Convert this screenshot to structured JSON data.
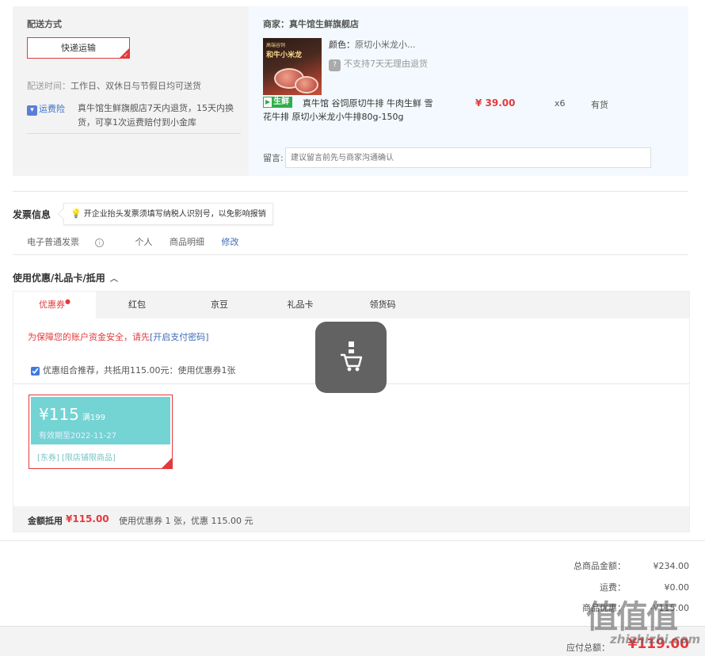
{
  "shipping": {
    "title": "配送方式",
    "option_label": "快递运输",
    "time_label": "配送时间：",
    "time_value": "工作日、双休日与节假日均可送货",
    "insurance_badge": "运费险",
    "insurance_text": "真牛馆生鲜旗舰店7天内退货，15天内换货，可享1次运费赔付到小金库"
  },
  "merchant": {
    "name": "商家：真牛馆生鲜旗舰店",
    "image_text_1": "高端谷饲",
    "image_text_2": "和牛小米龙",
    "color_label": "颜色：",
    "color_value": "原切小米龙小...",
    "return_policy": "不支持7天无理由退货",
    "fresh_tag": "生鲜",
    "product_title": "真牛馆 谷饲原切牛排 牛肉生鲜 雪花牛排 原切小米龙小牛排80g-150g",
    "price": "¥ 39.00",
    "qty": "x6",
    "stock": "有货",
    "note_label": "留言:",
    "note_placeholder": "建议留言前先与商家沟通确认"
  },
  "invoice": {
    "title": "发票信息",
    "tip": "开企业抬头发票须填写纳税人识别号，以免影响报销",
    "type": "电子普通发票",
    "holder": "个人",
    "content": "商品明细",
    "edit": "修改"
  },
  "coupon": {
    "title": "使用优惠/礼品卡/抵用",
    "tabs": [
      {
        "label": "优惠券",
        "active": true
      },
      {
        "label": "红包"
      },
      {
        "label": "京豆"
      },
      {
        "label": "礼品卡"
      },
      {
        "label": "领货码"
      }
    ],
    "tab_dot": "●",
    "security_tip": "为保障您的账户资金安全，请先",
    "security_link": "[开启支付密码]",
    "combo_text": "优惠组合推荐，共抵用115.00元：使用优惠券1张",
    "card": {
      "amount": "¥115",
      "condition": "满199",
      "expire": "有效期至2022-11-27",
      "tags": "[东券] [限店铺限商品]"
    },
    "summary_label": "金额抵用",
    "summary_amount": "¥115.00",
    "summary_desc": "使用优惠券 1 张，优惠 115.00 元"
  },
  "totals": {
    "goods_label": "总商品金额：",
    "goods_value": "¥234.00",
    "shipping_label": "运费：",
    "shipping_value": "¥0.00",
    "discount_label": "商品优惠：",
    "discount_value": "-¥115.00",
    "pay_label": "应付总额：",
    "pay_value": "¥119.00"
  },
  "watermark": {
    "glyphs": "值值值",
    "site": "zhizhizhi.com"
  },
  "colors": {
    "accent": "#e4393c",
    "link": "#3e6bb8",
    "coupon": "#74d3d3",
    "fresh": "#2fad4b"
  }
}
